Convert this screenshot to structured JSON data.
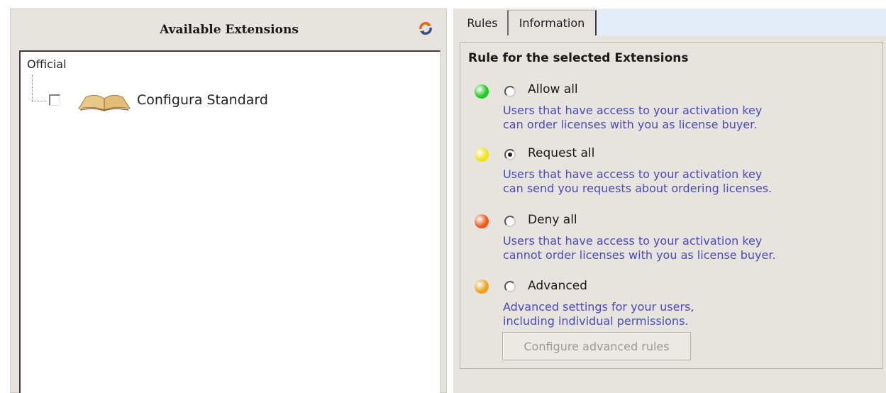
{
  "left_panel": {
    "title": "Available Extensions",
    "refresh_icon": "refresh-icon",
    "tree": {
      "root_label": "Official",
      "items": [
        {
          "label": "Configura Standard",
          "checked": false,
          "icon": "book-icon"
        }
      ]
    }
  },
  "right_panel": {
    "tabs": [
      {
        "label": "Rules",
        "active": true
      },
      {
        "label": "Information",
        "active": false
      }
    ],
    "heading": "Rule for the selected Extensions",
    "rules": [
      {
        "label": "Allow all",
        "selected": false,
        "color": "#22cc22",
        "desc_line1": "Users that have access to your activation key",
        "desc_line2": "can order licenses with you as license buyer."
      },
      {
        "label": "Request all",
        "selected": true,
        "color": "#f2e21c",
        "desc_line1": "Users that have access to your activation key",
        "desc_line2": "can send you requests about ordering licenses."
      },
      {
        "label": "Deny all",
        "selected": false,
        "color": "#ee5a1c",
        "desc_line1": "Users that have access to your activation key",
        "desc_line2": "cannot order licenses with you as license buyer."
      },
      {
        "label": "Advanced",
        "selected": false,
        "color": "#f0a21c",
        "desc_line1": "Advanced settings for your users,",
        "desc_line2": "including individual permissions."
      }
    ],
    "configure_button": "Configure advanced rules"
  },
  "colors": {
    "panel_bg": "#e7e3de",
    "description_text": "#4a4ab8",
    "tab_bar_bg": "#e3ecf8"
  }
}
